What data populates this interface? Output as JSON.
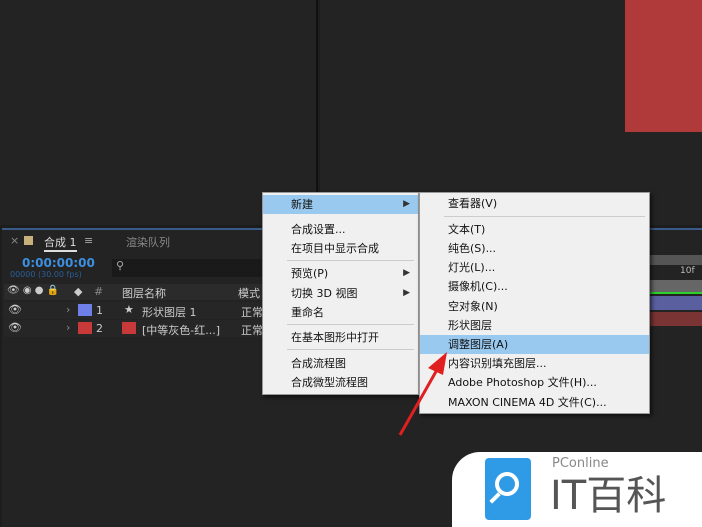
{
  "timeline": {
    "tab_comp": "合成 1",
    "tab_render": "渲染队列",
    "timecode": "0:00:00:00",
    "fps": "00000 (30.00 fps)",
    "col_name": "图层名称",
    "col_mode": "模式",
    "col_num": "#",
    "ruler": "10f",
    "layers": [
      {
        "num": "1",
        "name": "形状图层 1",
        "mode": "正常",
        "color": "#6f7fe8"
      },
      {
        "num": "2",
        "name": "[中等灰色-红...]",
        "mode": "正常",
        "color": "#c83a3a"
      }
    ]
  },
  "context_menu": {
    "items": [
      "新建",
      "合成设置...",
      "在项目中显示合成",
      "预览(P)",
      "切换 3D 视图",
      "重命名",
      "在基本图形中打开",
      "合成流程图",
      "合成微型流程图"
    ]
  },
  "submenu": {
    "items": [
      "查看器(V)",
      "文本(T)",
      "纯色(S)...",
      "灯光(L)...",
      "摄像机(C)...",
      "空对象(N)",
      "形状图层",
      "调整图层(A)",
      "内容识别填充图层...",
      "Adobe Photoshop 文件(H)...",
      "MAXON CINEMA 4D 文件(C)..."
    ]
  },
  "watermark": {
    "brand": "PConline",
    "name": "IT百科"
  },
  "colors": {
    "highlight": "#99c9ef",
    "timecode": "#3d8fe0",
    "arrow": "#e02020"
  }
}
